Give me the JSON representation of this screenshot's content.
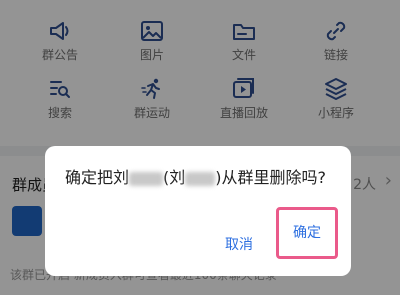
{
  "tools": [
    {
      "label": "群公告",
      "icon": "speaker-icon"
    },
    {
      "label": "图片",
      "icon": "image-icon"
    },
    {
      "label": "文件",
      "icon": "folder-icon"
    },
    {
      "label": "链接",
      "icon": "link-icon"
    },
    {
      "label": "搜索",
      "icon": "search-list-icon"
    },
    {
      "label": "群运动",
      "icon": "running-icon"
    },
    {
      "label": "直播回放",
      "icon": "video-playback-icon"
    },
    {
      "label": "小程序",
      "icon": "layers-icon"
    }
  ],
  "members": {
    "title": "群成员",
    "count": "2人"
  },
  "footnote": "该群已开启 新成员入群可查看最近100条聊天记录",
  "dialog": {
    "message_part1": "确定把刘",
    "message_part2": "(刘",
    "message_part3": ")从群里删除吗?",
    "cancel": "取消",
    "confirm": "确定"
  },
  "colors": {
    "accent": "#2d6fe0",
    "highlight": "#ea5a8a"
  }
}
